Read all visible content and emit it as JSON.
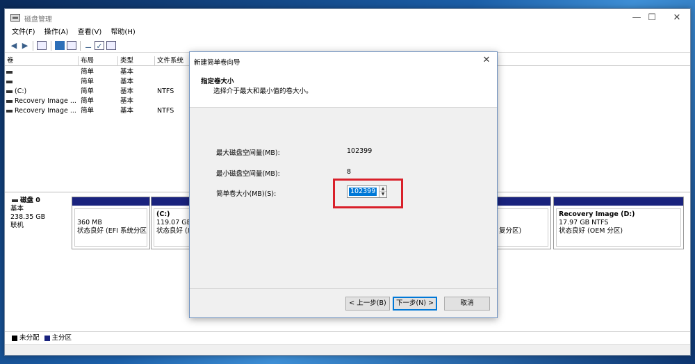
{
  "window": {
    "title": "磁盘管理",
    "minimize": "—",
    "maximize": "☐",
    "close": "✕"
  },
  "menu": [
    "文件(F)",
    "操作(A)",
    "查看(V)",
    "帮助(H)"
  ],
  "volume_list": {
    "headers": [
      "卷",
      "布局",
      "类型",
      "文件系统"
    ],
    "rows": [
      {
        "volume": "",
        "layout": "简单",
        "type": "基本",
        "fs": ""
      },
      {
        "volume": "",
        "layout": "简单",
        "type": "基本",
        "fs": ""
      },
      {
        "volume": "(C:)",
        "layout": "简单",
        "type": "基本",
        "fs": "NTFS"
      },
      {
        "volume": "Recovery Image ...",
        "layout": "简单",
        "type": "基本",
        "fs": ""
      },
      {
        "volume": "Recovery Image ...",
        "layout": "简单",
        "type": "基本",
        "fs": "NTFS"
      }
    ]
  },
  "disk": {
    "name": "磁盘 0",
    "type": "基本",
    "size": "238.35 GB",
    "status": "联机"
  },
  "partitions": [
    {
      "name": "",
      "size": "360 MB",
      "status": "状态良好 (EFI 系统分区)"
    },
    {
      "name": "(C:)",
      "size": "119.07 GB (",
      "status": "状态良好 (启"
    },
    {
      "name": "",
      "size": "",
      "status": "复分区)"
    },
    {
      "name": "Recovery Image  (D:)",
      "size": "17.97 GB NTFS",
      "status": "状态良好 (OEM 分区)"
    }
  ],
  "legend": [
    {
      "label": "未分配",
      "color": "#000000"
    },
    {
      "label": "主分区",
      "color": "#1a237e"
    }
  ],
  "dialog": {
    "title": "新建简单卷向导",
    "close": "✕",
    "header_title": "指定卷大小",
    "header_subtitle": "选择介于最大和最小值的卷大小。",
    "max_label": "最大磁盘空间量(MB):",
    "max_value": "102399",
    "min_label": "最小磁盘空间量(MB):",
    "min_value": "8",
    "size_label": "简单卷大小(MB)(S):",
    "size_value": "102399",
    "spin_up": "▲",
    "spin_down": "▼",
    "back_button": "< 上一步(B)",
    "next_button": "下一步(N) >",
    "cancel_button": "取消"
  },
  "colors": {
    "partition_bar": "#1a237e",
    "highlight": "#d9202a",
    "selection": "#0078d7"
  }
}
